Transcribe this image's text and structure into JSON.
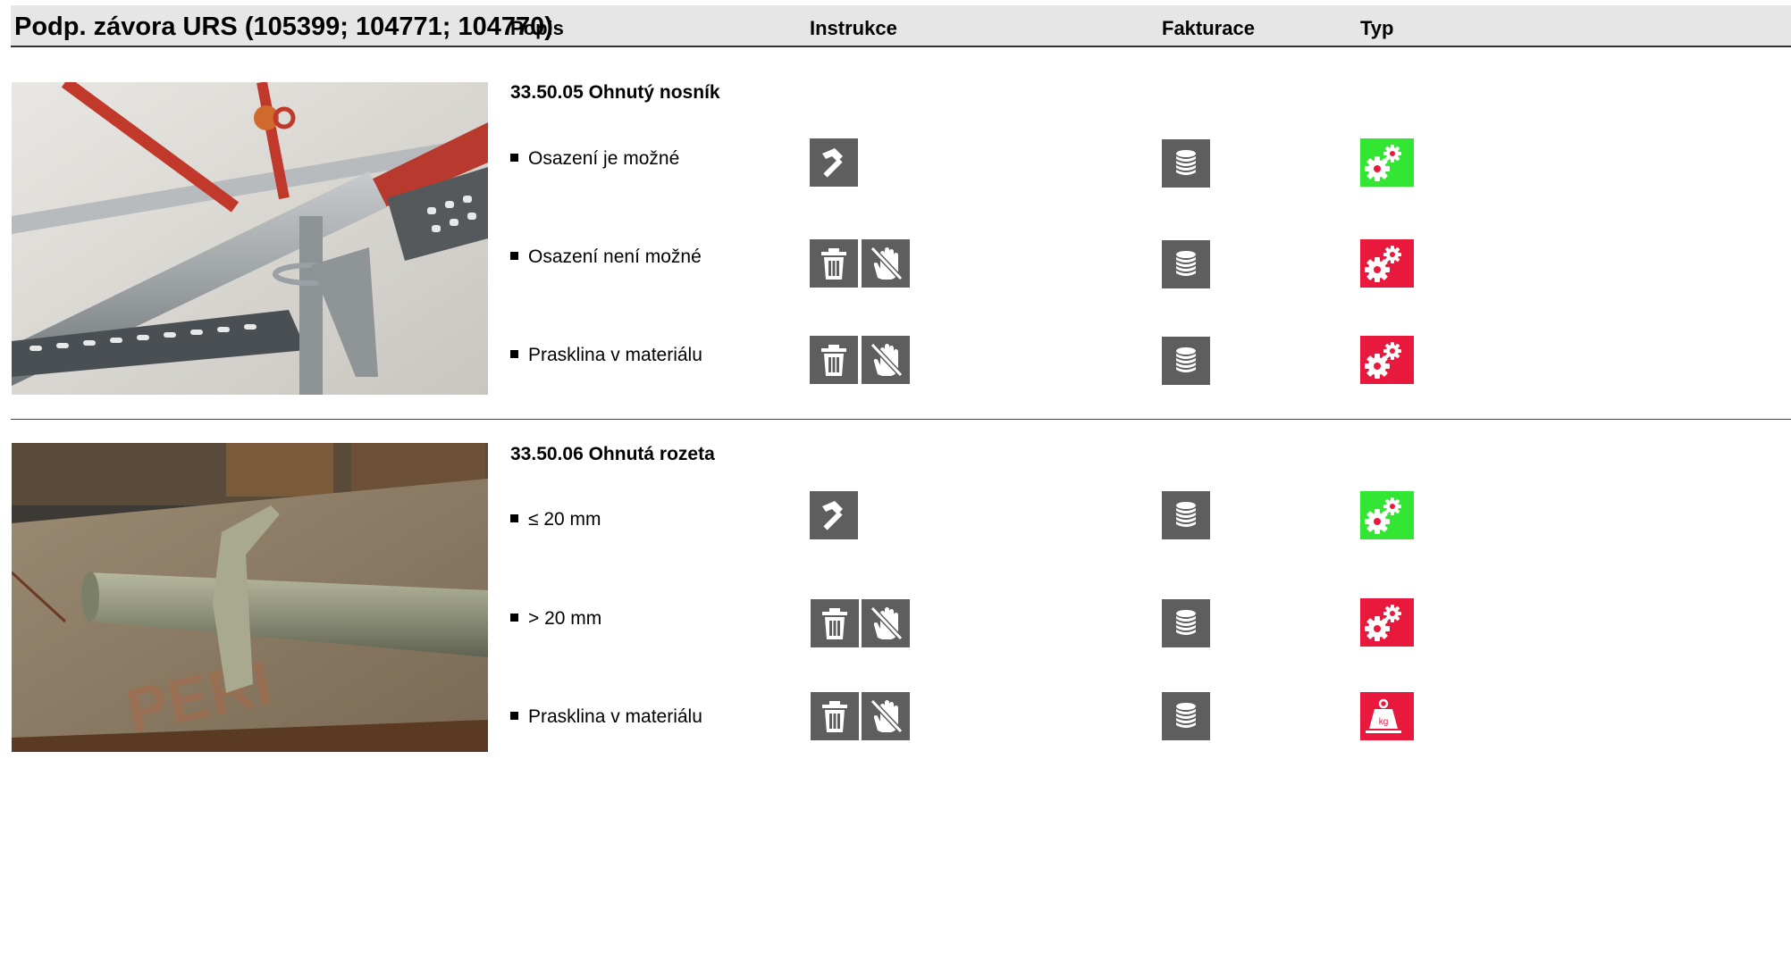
{
  "header": {
    "title": "Podp. závora URS (105399; 104771; 104770)",
    "col_popis": "Popis",
    "col_instrukce": "Instrukce",
    "col_fakturace": "Fakturace",
    "col_typ": "Typ"
  },
  "colors": {
    "header_bg": "#e6e6e6",
    "icon_bg": "#5e5e5e",
    "type_green": "#33e633",
    "type_red": "#e8193c"
  },
  "sections": [
    {
      "title": "33.50.05 Ohnutý nosník",
      "rows": [
        {
          "label": "Osazení je možné",
          "instrukce": [
            "hammer-icon"
          ],
          "fakturace": "coins-icon",
          "typ": "gears-icon",
          "typ_color": "green"
        },
        {
          "label": "Osazení není možné",
          "instrukce": [
            "trash-icon",
            "no-touch-icon"
          ],
          "fakturace": "coins-icon",
          "typ": "gears-icon",
          "typ_color": "red"
        },
        {
          "label": "Prasklina v materiálu",
          "instrukce": [
            "trash-icon",
            "no-touch-icon"
          ],
          "fakturace": "coins-icon",
          "typ": "gears-icon",
          "typ_color": "red"
        }
      ]
    },
    {
      "title": "33.50.06 Ohnutá rozeta",
      "rows": [
        {
          "label": "≤ 20 mm",
          "instrukce": [
            "hammer-icon"
          ],
          "fakturace": "coins-icon",
          "typ": "gears-icon",
          "typ_color": "green"
        },
        {
          "label": "> 20 mm",
          "instrukce": [
            "trash-icon",
            "no-touch-icon"
          ],
          "fakturace": "coins-icon",
          "typ": "gears-icon",
          "typ_color": "red"
        },
        {
          "label": "Prasklina v materiálu",
          "instrukce": [
            "trash-icon",
            "no-touch-icon"
          ],
          "fakturace": "coins-icon",
          "typ": "weight-icon",
          "typ_color": "red"
        }
      ]
    }
  ],
  "weight_badge_text": "kg"
}
